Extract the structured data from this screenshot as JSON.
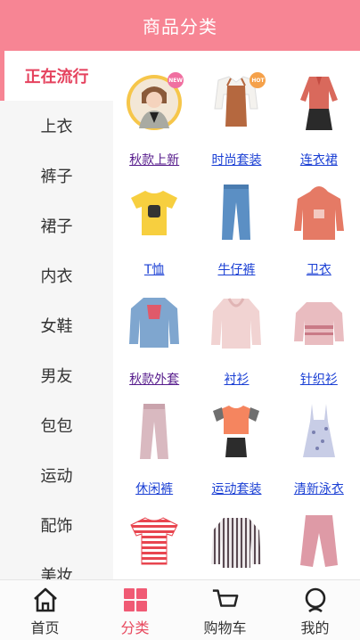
{
  "header": {
    "title": "商品分类"
  },
  "sidebar": {
    "items": [
      {
        "label": "正在流行"
      },
      {
        "label": "上衣"
      },
      {
        "label": "裤子"
      },
      {
        "label": "裙子"
      },
      {
        "label": "内衣"
      },
      {
        "label": "女鞋"
      },
      {
        "label": "男友"
      },
      {
        "label": "包包"
      },
      {
        "label": "运动"
      },
      {
        "label": "配饰"
      },
      {
        "label": "美妆"
      }
    ]
  },
  "grid": {
    "items": [
      {
        "label": "秋款上新",
        "icon": "girl-jacket-photo-icon",
        "badge": "NEW"
      },
      {
        "label": "时尚套装",
        "icon": "fashion-set-icon",
        "badge": "HOT"
      },
      {
        "label": "连衣裙",
        "icon": "dress-icon"
      },
      {
        "label": "T恤",
        "icon": "tshirt-icon"
      },
      {
        "label": "牛仔裤",
        "icon": "jeans-icon"
      },
      {
        "label": "卫衣",
        "icon": "hoodie-icon"
      },
      {
        "label": "秋款外套",
        "icon": "denim-jacket-icon"
      },
      {
        "label": "衬衫",
        "icon": "blouse-icon"
      },
      {
        "label": "针织衫",
        "icon": "knit-sweater-icon"
      },
      {
        "label": "休闲裤",
        "icon": "casual-pants-icon"
      },
      {
        "label": "运动套装",
        "icon": "sport-set-icon"
      },
      {
        "label": "清新泳衣",
        "icon": "swimsuit-icon"
      },
      {
        "label": "",
        "icon": "striped-tshirt-icon"
      },
      {
        "label": "",
        "icon": "striped-shirt-icon"
      },
      {
        "label": "",
        "icon": "pink-pants-icon"
      }
    ]
  },
  "tabbar": {
    "items": [
      {
        "label": "首页",
        "icon": "home-icon"
      },
      {
        "label": "分类",
        "icon": "category-icon"
      },
      {
        "label": "购物车",
        "icon": "cart-icon"
      },
      {
        "label": "我的",
        "icon": "profile-icon"
      }
    ]
  },
  "colors": {
    "accent": "#f78594",
    "active_text": "#e5425e",
    "link": "#1a3fd4",
    "visited_link": "#551a8b"
  }
}
